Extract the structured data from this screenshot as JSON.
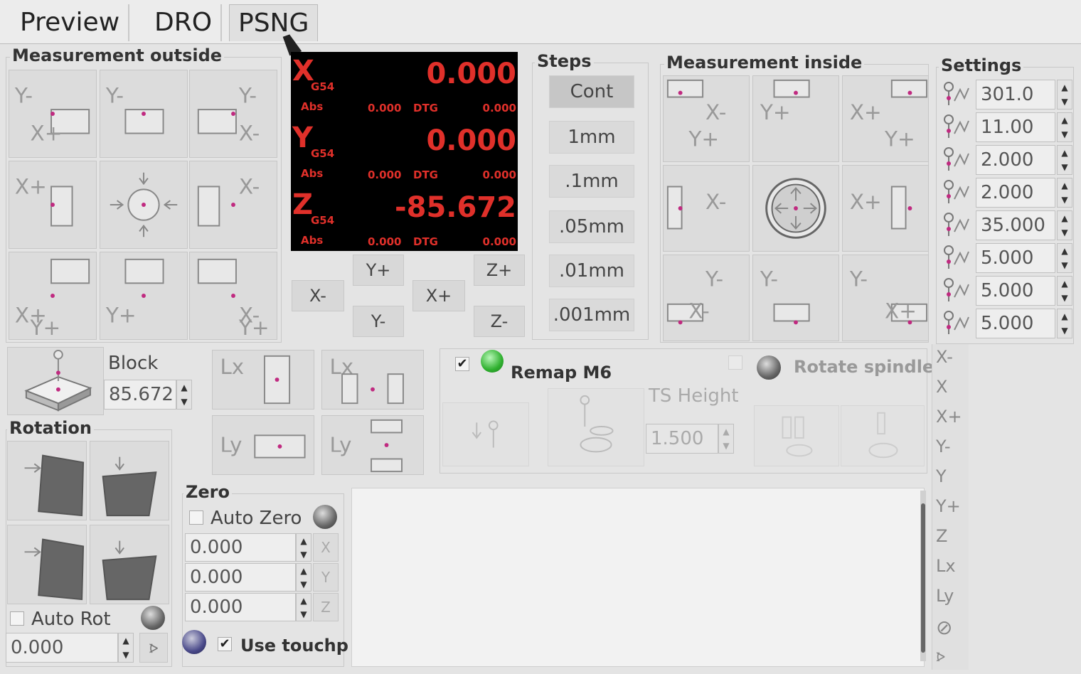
{
  "tabs": [
    {
      "label": "Preview"
    },
    {
      "label": "DRO"
    },
    {
      "label": "PSNG"
    }
  ],
  "measurement_outside": {
    "title": "Measurement outside",
    "buttons": [
      {
        "a": "Y-",
        "b": "X+"
      },
      {
        "a": "Y-",
        "b": ""
      },
      {
        "a": "Y-",
        "b": "X-"
      },
      {
        "a": "X+",
        "b": ""
      },
      {
        "a": "",
        "b": ""
      },
      {
        "a": "X-",
        "b": ""
      },
      {
        "a": "X+",
        "b": "Y+"
      },
      {
        "a": "Y+",
        "b": ""
      },
      {
        "a": "X-",
        "b": "Y+"
      }
    ]
  },
  "dro": {
    "axes": [
      {
        "axis": "X",
        "coord": "G54",
        "value": "0.000",
        "abs_label": "Abs",
        "abs_value": "0.000",
        "dtg_label": "DTG",
        "dtg_value": "0.000"
      },
      {
        "axis": "Y",
        "coord": "G54",
        "value": "0.000",
        "abs_label": "Abs",
        "abs_value": "0.000",
        "dtg_label": "DTG",
        "dtg_value": "0.000"
      },
      {
        "axis": "Z",
        "coord": "G54",
        "value": "-85.672",
        "abs_label": "Abs",
        "abs_value": "0.000",
        "dtg_label": "DTG",
        "dtg_value": "0.000"
      }
    ]
  },
  "jog": {
    "y_plus": "Y+",
    "x_minus": "X-",
    "x_plus": "X+",
    "y_minus": "Y-",
    "z_plus": "Z+",
    "z_minus": "Z-"
  },
  "steps": {
    "title": "Steps",
    "items": [
      "Cont",
      "1mm",
      ".1mm",
      ".05mm",
      ".01mm",
      ".001mm"
    ],
    "selected": "Cont"
  },
  "measurement_inside": {
    "title": "Measurement inside",
    "buttons": [
      {
        "a": "X-",
        "b": "Y+"
      },
      {
        "a": "Y+",
        "b": ""
      },
      {
        "a": "X+",
        "b": "Y+"
      },
      {
        "a": "X-",
        "b": ""
      },
      {
        "a": "",
        "b": ""
      },
      {
        "a": "X+",
        "b": ""
      },
      {
        "a": "Y-",
        "b": "X-"
      },
      {
        "a": "Y-",
        "b": ""
      },
      {
        "a": "Y-",
        "b": "X+"
      }
    ]
  },
  "settings": {
    "title": "Settings",
    "values": [
      "301.0",
      "11.00",
      "2.000",
      "2.000",
      "35.000",
      "5.000",
      "5.000",
      "5.000"
    ]
  },
  "block": {
    "label": "Block",
    "value": "85.672"
  },
  "length": {
    "lx": "Lx",
    "ly": "Ly"
  },
  "remap": {
    "checked": true,
    "label": "Remap M6",
    "rotate_label": "Rotate spindle",
    "ts_height_label": "TS Height",
    "ts_height_value": "1.500",
    "led_color": "#39c13c"
  },
  "rotation": {
    "title": "Rotation",
    "auto_rot_label": "Auto Rot",
    "value": "0.000"
  },
  "zero": {
    "title": "Zero",
    "auto_zero_label": "Auto Zero",
    "x_value": "0.000",
    "y_value": "0.000",
    "z_value": "0.000",
    "x_btn": "X",
    "y_btn": "Y",
    "z_btn": "Z",
    "use_touchp_label": "Use touchp",
    "use_touchp_checked": true
  },
  "sidebar": {
    "items": [
      "X-",
      "X",
      "X+",
      "Y-",
      "Y",
      "Y+",
      "Z",
      "Lx",
      "Ly",
      "",
      ""
    ]
  },
  "colors": {
    "dro_red": "#e0302a",
    "dro_bg": "#000000",
    "accent_magenta": "#c02a80"
  }
}
